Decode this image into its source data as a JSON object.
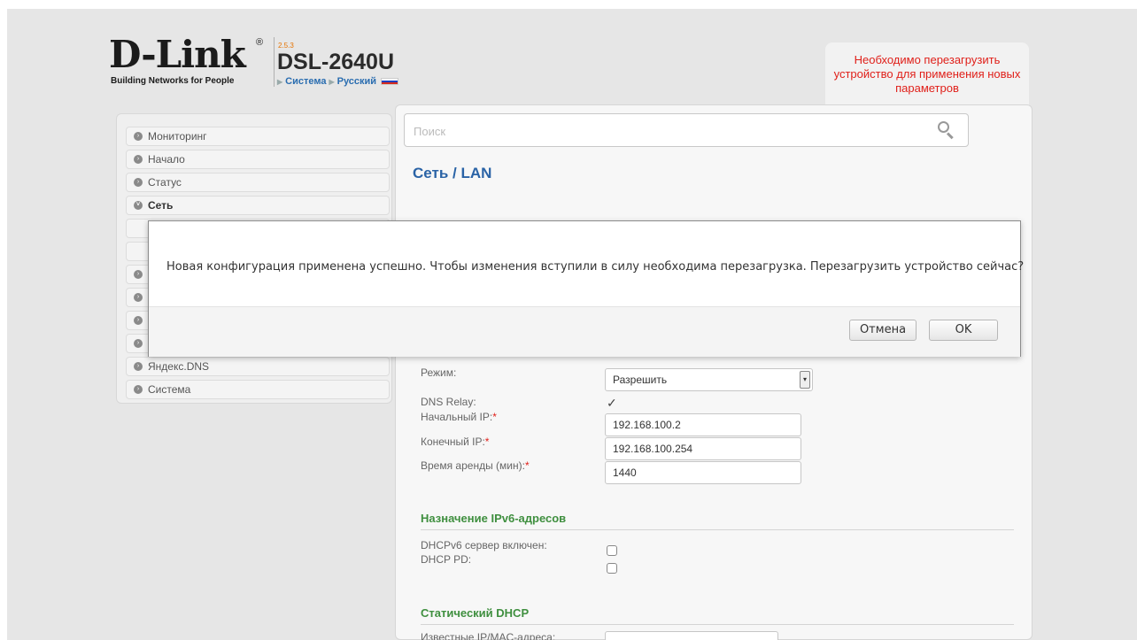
{
  "header": {
    "logo_text": "D-Link",
    "logo_tagline": "Building Networks for People",
    "firmware_version": "2.5.3",
    "model": "DSL-2640U",
    "breadcrumb": [
      "Система",
      "Русский"
    ],
    "language_flag": "russia-flag-icon"
  },
  "reboot_notice": {
    "text": "Необходимо перезагрузить устройство для применения новых параметров",
    "count": "1"
  },
  "search": {
    "placeholder": "Поиск"
  },
  "sidebar": {
    "items": [
      {
        "label": "Мониторинг",
        "icon": "chevron-right-icon"
      },
      {
        "label": "Начало",
        "icon": "chevron-right-icon"
      },
      {
        "label": "Статус",
        "icon": "chevron-right-icon"
      },
      {
        "label": "Сеть",
        "icon": "chevron-down-icon",
        "active": true
      },
      {
        "label": "Яндекс.DNS",
        "icon": "chevron-right-icon"
      },
      {
        "label": "Система",
        "icon": "chevron-right-icon"
      }
    ]
  },
  "page": {
    "title": "Сеть /  LAN"
  },
  "dhcp": {
    "mode_label": "Режим:",
    "mode_value": "Разрешить",
    "dns_relay_label": "DNS Relay:",
    "dns_relay_checked": true,
    "start_ip_label": "Начальный IP:",
    "start_ip_value": "192.168.100.2",
    "end_ip_label": "Конечный IP:",
    "end_ip_value": "192.168.100.254",
    "lease_label": "Время аренды (мин):",
    "lease_value": "1440",
    "required_mark": "*"
  },
  "ipv6": {
    "section_title": "Назначение IPv6-адресов",
    "dhcpv6_label": "DHCPv6 сервер включен:",
    "dhcpv6_checked": false,
    "dhcp_pd_label": "DHCP PD:",
    "dhcp_pd_checked": false
  },
  "static_dhcp": {
    "section_title": "Статический DHCP",
    "known_label": "Известные IP/MAC-адреса:"
  },
  "modal": {
    "message": "Новая конфигурация применена успешно. Чтобы изменения вступили в силу необходима перезагрузка. Перезагрузить устройство сейчас?",
    "cancel_label": "Отмена",
    "ok_label": "OK"
  },
  "colors": {
    "accent_blue": "#2a63a6",
    "alert_red": "#e0201a",
    "section_green": "#3f8f3f"
  }
}
